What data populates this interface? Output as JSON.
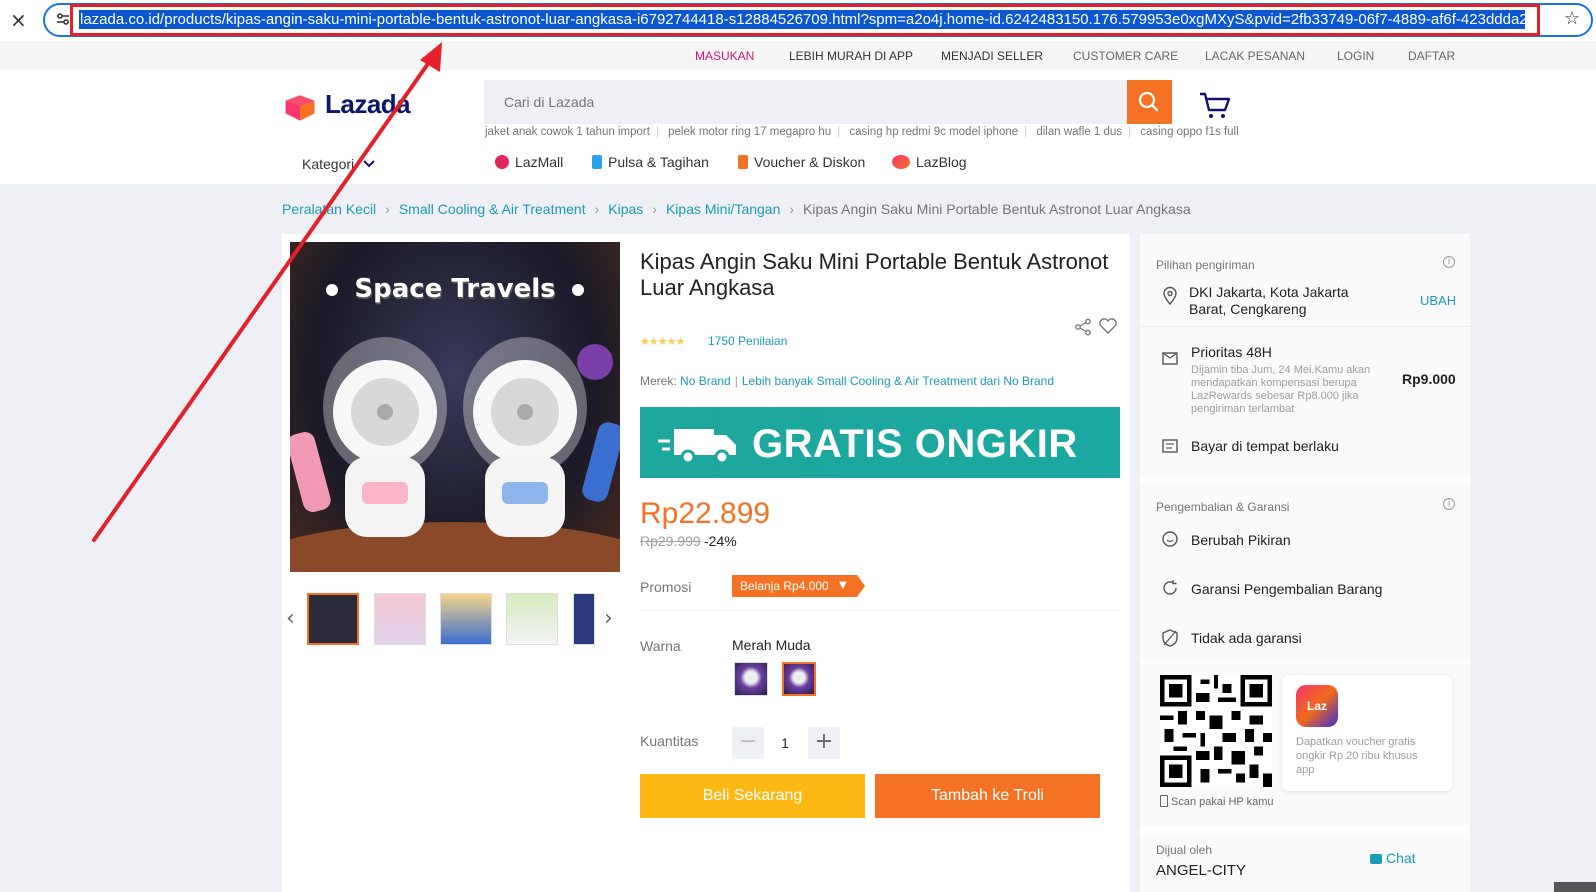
{
  "browser": {
    "url": "lazada.co.id/products/kipas-angin-saku-mini-portable-bentuk-astronot-luar-angkasa-i6792744418-s12884526709.html?spm=a2o4j.home-id.6242483150.176.579953e0xgMXyS&pvid=2fb33749-06f7-4889-af6f-423ddda2",
    "close_icon": "×",
    "star_icon": "☆"
  },
  "toplinks": {
    "masukan": "MASUKAN",
    "lebih_murah": "LEBIH MURAH DI APP",
    "menjadi_seller": "MENJADI SELLER",
    "customer_care": "CUSTOMER CARE",
    "lacak_pesanan": "LACAK PESANAN",
    "login": "LOGIN",
    "daftar": "DAFTAR"
  },
  "header": {
    "logo_text": "Lazada",
    "search_placeholder": "Cari di Lazada",
    "suggestions": [
      "jaket anak cowok 1 tahun import",
      "pelek motor ring 17 megapro hu",
      "casing hp redmi 9c model iphone",
      "dilan wafle 1 dus",
      "casing oppo f1s full"
    ],
    "kategori": "Kategori",
    "nav": {
      "lazmall": "LazMall",
      "pulsa": "Pulsa & Tagihan",
      "voucher": "Voucher & Diskon",
      "lazblog": "LazBlog"
    }
  },
  "breadcrumb": {
    "items": [
      "Peralatan Kecil",
      "Small Cooling & Air Treatment",
      "Kipas",
      "Kipas Mini/Tangan"
    ],
    "current": "Kipas Angin Saku Mini Portable Bentuk Astronot Luar Angkasa",
    "separator": "›"
  },
  "product": {
    "image_caption": "Space Travels",
    "title": "Kipas Angin Saku Mini Portable Bentuk Astronot Luar Angkasa",
    "stars": "★★★★★",
    "rating_count": "1750 Penilaian",
    "brand_label": "Merek:",
    "brand_name": "No Brand",
    "more_link": "Lebih banyak Small Cooling & Air Treatment dari No Brand",
    "banner_text": "GRATIS ONGKIR",
    "price": "Rp22.899",
    "old_price": "Rp29.999",
    "discount": "-24%",
    "promo_label": "Promosi",
    "promo_tag": "Belanja Rp4.000",
    "color_label": "Warna",
    "color_value": "Merah Muda",
    "qty_label": "Kuantitas",
    "qty_minus": "−",
    "qty_value": "1",
    "qty_plus": "+",
    "buy_now": "Beli Sekarang",
    "add_cart": "Tambah ke Troli",
    "prev_arrow": "‹",
    "next_arrow": "›"
  },
  "delivery": {
    "heading": "Pilihan pengiriman",
    "info": "i",
    "location": "DKI Jakarta, Kota Jakarta Barat, Cengkareng",
    "change": "UBAH",
    "priority_title": "Prioritas 48H",
    "priority_desc": "Dijamin tiba Jum, 24 Mei.Kamu akan mendapatkan kompensasi berupa LazRewards sebesar Rp8.000 jika pengiriman terlambat",
    "priority_price": "Rp9.000",
    "cod": "Bayar di tempat berlaku"
  },
  "returns": {
    "heading": "Pengembalian & Garansi",
    "info": "i",
    "change_mind": "Berubah Pikiran",
    "return_guarantee": "Garansi Pengembalian Barang",
    "no_warranty": "Tidak ada garansi"
  },
  "app_promo": {
    "laz_icon_text": "Laz",
    "text": "Dapatkan voucher gratis ongkir Rp 20 ribu khusus app",
    "scan_text": "Scan pakai HP kamu"
  },
  "seller": {
    "label": "Dijual oleh",
    "name": "ANGEL-CITY",
    "chat": "Chat"
  },
  "colors": {
    "lazada_orange": "#f57224",
    "link_blue": "#1a9cb7",
    "banner_teal": "#1ea79c",
    "buy_yellow": "#fdb813",
    "annotation_red": "#e5202a"
  }
}
